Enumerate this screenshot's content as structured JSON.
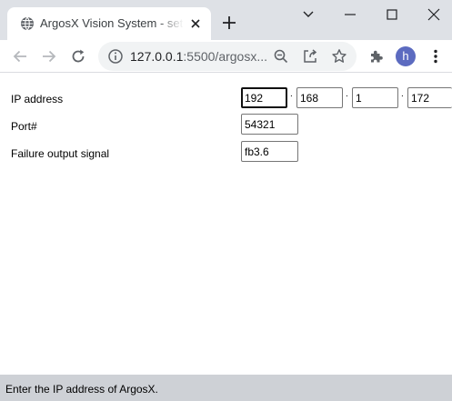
{
  "browser": {
    "tab": {
      "title": "ArgosX Vision System - setup"
    },
    "address_bar": {
      "host": "127.0.0.1",
      "rest": ":5500/argosx..."
    },
    "profile_initial": "h"
  },
  "form": {
    "ip_address": {
      "label": "IP address",
      "octets": [
        "192",
        "168",
        "1",
        "172"
      ],
      "separator": "."
    },
    "port": {
      "label": "Port#",
      "value": "54321"
    },
    "failure_output_signal": {
      "label": "Failure output signal",
      "value": "fb3.6"
    }
  },
  "status_bar": {
    "text": "Enter the IP address of ArgosX."
  },
  "colors": {
    "tab_strip": "#dee1e6",
    "status_bar": "#ced1d6",
    "avatar": "#5c6bc0",
    "focus_border": "#101010"
  },
  "icons": {
    "tab": [
      "globe-icon",
      "close-icon",
      "plus-icon"
    ],
    "window": [
      "chevron-down-icon",
      "minimize-icon",
      "maximize-icon",
      "close-window-icon"
    ],
    "toolbar": [
      "back-arrow-icon",
      "forward-arrow-icon",
      "reload-icon",
      "info-icon",
      "zoom-out-icon",
      "share-icon",
      "star-icon",
      "puzzle-icon",
      "more-vert-icon"
    ]
  }
}
